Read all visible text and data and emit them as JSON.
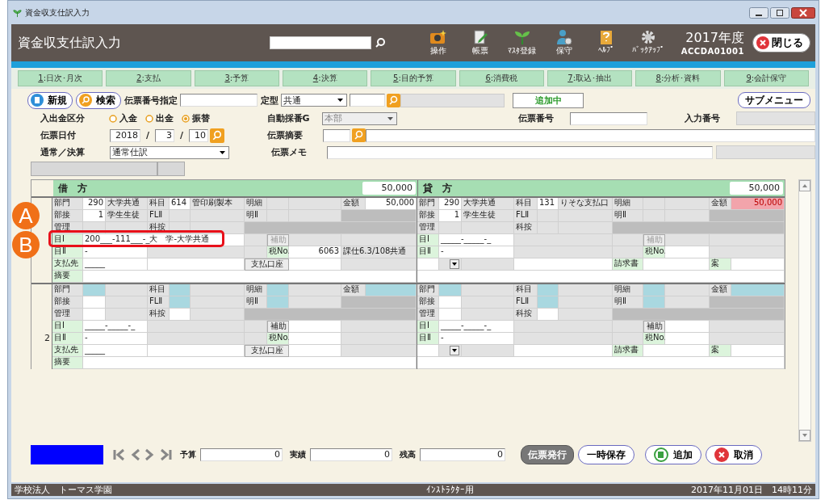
{
  "window": {
    "title": "資金収支仕訳入力"
  },
  "header": {
    "title": "資金収支仕訳入力",
    "icons": [
      {
        "kind": "camera",
        "label": "操作"
      },
      {
        "kind": "memo",
        "label": "帳票"
      },
      {
        "kind": "sprout",
        "label": "ﾏｽﾀ登録"
      },
      {
        "kind": "person",
        "label": "保守"
      },
      {
        "kind": "book",
        "label": "ﾍﾙﾌﾟ"
      },
      {
        "kind": "gear",
        "label": "ﾊﾞｯｸｱｯﾌﾟ"
      }
    ],
    "fiscal_year": "2017年度",
    "screen_id": "ACCDA01001",
    "close_button": "閉じる"
  },
  "tabs": [
    {
      "key": "1",
      "label": ":日次･月次",
      "selected": false
    },
    {
      "key": "2",
      "label": ":支払",
      "selected": false
    },
    {
      "key": "3",
      "label": ":予算",
      "selected": false
    },
    {
      "key": "4",
      "label": ":決算",
      "selected": false
    },
    {
      "key": "5",
      "label": ":目的予算",
      "selected": false
    },
    {
      "key": "6",
      "label": ":消費税",
      "selected": false
    },
    {
      "key": "7",
      "label": ":取込･抽出",
      "selected": false
    },
    {
      "key": "8",
      "label": ":分析･資料",
      "selected": false
    },
    {
      "key": "9",
      "label": ":会計保守",
      "selected": false
    }
  ],
  "form": {
    "new_button": "新規",
    "search_button": "検索",
    "voucher_no_spec_label": "伝票番号指定",
    "template_label": "定型",
    "template_value": "共通",
    "status": "追加中",
    "submenu_button": "サブメニュー",
    "direction_label": "入出金区分",
    "direction_options": [
      {
        "label": "入金",
        "selected": false
      },
      {
        "label": "出金",
        "selected": false
      },
      {
        "label": "振替",
        "selected": true
      }
    ],
    "auto_number_label": "自動採番G",
    "auto_number_value": "本部",
    "voucher_no_label": "伝票番号",
    "entry_no_label": "入力番号",
    "date_label": "伝票日付",
    "year": "2018",
    "month": "3",
    "day": "10",
    "date_separators": [
      "/",
      "/"
    ],
    "summary_label": "伝票摘要",
    "type_label": "通常／決算",
    "type_value": "通常仕訳",
    "memo_label": "伝票メモ"
  },
  "journal": {
    "debit_title": "借　方",
    "debit_total": "50,000",
    "credit_title": "貸　方",
    "credit_total": "50,000",
    "entries": [
      {
        "left": [
          [
            {
              "kind": "label",
              "text": "部門"
            },
            {
              "kind": "num",
              "text": "290"
            },
            {
              "kind": "gray",
              "text": "大学共通"
            },
            {
              "kind": "label",
              "text": "科目"
            },
            {
              "kind": "value",
              "text": "614"
            },
            {
              "kind": "gray",
              "text": "管印刷製本"
            },
            {
              "kind": "label",
              "text": "明細"
            },
            {
              "kind": "gray"
            },
            {
              "kind": "gray"
            },
            {
              "kind": "label",
              "text": "金額"
            },
            {
              "kind": "num",
              "text": "50,000"
            }
          ],
          [
            {
              "kind": "label",
              "text": "部接"
            },
            {
              "kind": "num",
              "text": "1"
            },
            {
              "kind": "gray",
              "text": "学生生徒"
            },
            {
              "kind": "label",
              "text": "FLⅡ"
            },
            {
              "kind": "gray"
            },
            {
              "kind": "gray"
            },
            {
              "kind": "label",
              "text": "明Ⅱ"
            },
            {
              "kind": "gray"
            },
            {
              "kind": "gray"
            },
            {
              "kind": "dark"
            }
          ],
          [
            {
              "kind": "label",
              "text": "管理"
            },
            {
              "kind": "gray"
            },
            {
              "kind": "gray"
            },
            {
              "kind": "label",
              "text": "科按"
            },
            {
              "kind": "gray"
            },
            {
              "kind": "gray"
            },
            {
              "kind": "dark"
            }
          ],
          [
            {
              "kind": "caption",
              "text": "目Ⅰ"
            },
            {
              "kind": "value",
              "text": "200___-111___-_大　学-大学共通"
            },
            {
              "kind": "gray"
            },
            {
              "kind": "button",
              "text": "補助",
              "disabled": true
            },
            {
              "kind": "gray"
            },
            {
              "kind": "gray"
            }
          ],
          [
            {
              "kind": "caption",
              "text": "目Ⅱ"
            },
            {
              "kind": "value",
              "text": "-"
            },
            {
              "kind": "gray"
            },
            {
              "kind": "gray"
            },
            {
              "kind": "caption",
              "text": "税No."
            },
            {
              "kind": "num",
              "text": "6063"
            },
            {
              "kind": "gray",
              "text": "課仕6.3/108共通"
            }
          ],
          [
            {
              "kind": "caption",
              "text": "支払先"
            },
            {
              "kind": "value",
              "text": "_____"
            },
            {
              "kind": "value"
            },
            {
              "kind": "button",
              "text": "支払口座",
              "disabled": false
            },
            {
              "kind": "value"
            },
            {
              "kind": "gray"
            }
          ],
          [
            {
              "kind": "caption",
              "text": "摘要"
            },
            {
              "kind": "value"
            }
          ]
        ],
        "right": [
          [
            {
              "kind": "label",
              "text": "部門"
            },
            {
              "kind": "num",
              "text": "290"
            },
            {
              "kind": "gray",
              "text": "大学共通"
            },
            {
              "kind": "label",
              "text": "科目"
            },
            {
              "kind": "value",
              "text": "131"
            },
            {
              "kind": "gray",
              "text": "りそな支払口"
            },
            {
              "kind": "label",
              "text": "明細"
            },
            {
              "kind": "gray"
            },
            {
              "kind": "gray"
            },
            {
              "kind": "label",
              "text": "金額"
            },
            {
              "kind": "pink",
              "text": "50,000"
            }
          ],
          [
            {
              "kind": "label",
              "text": "部接"
            },
            {
              "kind": "num",
              "text": "1"
            },
            {
              "kind": "gray",
              "text": "学生生徒"
            },
            {
              "kind": "label",
              "text": "FLⅡ"
            },
            {
              "kind": "gray"
            },
            {
              "kind": "gray"
            },
            {
              "kind": "label",
              "text": "明Ⅱ"
            },
            {
              "kind": "gray"
            },
            {
              "kind": "gray"
            },
            {
              "kind": "dark"
            }
          ],
          [
            {
              "kind": "label",
              "text": "管理"
            },
            {
              "kind": "gray"
            },
            {
              "kind": "gray"
            },
            {
              "kind": "label",
              "text": "科按"
            },
            {
              "kind": "gray"
            },
            {
              "kind": "gray"
            },
            {
              "kind": "dark"
            }
          ],
          [
            {
              "kind": "caption",
              "text": "目Ⅰ"
            },
            {
              "kind": "value",
              "text": "_____-_____-_"
            },
            {
              "kind": "gray"
            },
            {
              "kind": "gray"
            },
            {
              "kind": "button",
              "text": "補助",
              "disabled": true
            },
            {
              "kind": "gray"
            },
            {
              "kind": "gray"
            }
          ],
          [
            {
              "kind": "caption",
              "text": "目Ⅱ"
            },
            {
              "kind": "value",
              "text": "-"
            },
            {
              "kind": "gray"
            },
            {
              "kind": "gray"
            },
            {
              "kind": "caption",
              "text": "税No."
            },
            {
              "kind": "value"
            },
            {
              "kind": "gray"
            }
          ],
          [
            {
              "kind": "value"
            },
            {
              "kind": "drop"
            },
            {
              "kind": "gray"
            },
            {
              "kind": "value"
            },
            {
              "kind": "caption",
              "text": "請求書"
            },
            {
              "kind": "value"
            },
            {
              "kind": "caption",
              "text": "案"
            },
            {
              "kind": "value"
            }
          ],
          [
            {
              "kind": "value"
            }
          ]
        ]
      },
      {
        "number": "2",
        "left": [
          [
            {
              "kind": "label",
              "text": "部門"
            },
            {
              "kind": "blue"
            },
            {
              "kind": "gray"
            },
            {
              "kind": "label",
              "text": "科目"
            },
            {
              "kind": "blue"
            },
            {
              "kind": "gray"
            },
            {
              "kind": "label",
              "text": "明細"
            },
            {
              "kind": "blue"
            },
            {
              "kind": "gray"
            },
            {
              "kind": "label",
              "text": "金額"
            },
            {
              "kind": "blue"
            }
          ],
          [
            {
              "kind": "label",
              "text": "部接"
            },
            {
              "kind": "value"
            },
            {
              "kind": "gray"
            },
            {
              "kind": "label",
              "text": "FLⅡ"
            },
            {
              "kind": "blue"
            },
            {
              "kind": "gray"
            },
            {
              "kind": "label",
              "text": "明Ⅱ"
            },
            {
              "kind": "blue"
            },
            {
              "kind": "gray"
            },
            {
              "kind": "dark"
            }
          ],
          [
            {
              "kind": "label",
              "text": "管理"
            },
            {
              "kind": "value"
            },
            {
              "kind": "gray"
            },
            {
              "kind": "label",
              "text": "科按"
            },
            {
              "kind": "value"
            },
            {
              "kind": "gray"
            },
            {
              "kind": "dark"
            }
          ],
          [
            {
              "kind": "caption",
              "text": "目Ⅰ"
            },
            {
              "kind": "value",
              "text": "_____-_____-_"
            },
            {
              "kind": "gray"
            },
            {
              "kind": "gray"
            },
            {
              "kind": "button",
              "text": "補助",
              "disabled": false
            },
            {
              "kind": "value"
            },
            {
              "kind": "gray"
            }
          ],
          [
            {
              "kind": "caption",
              "text": "目Ⅱ"
            },
            {
              "kind": "value",
              "text": "-"
            },
            {
              "kind": "gray"
            },
            {
              "kind": "gray"
            },
            {
              "kind": "caption",
              "text": "税No."
            },
            {
              "kind": "value"
            },
            {
              "kind": "gray"
            }
          ],
          [
            {
              "kind": "caption",
              "text": "支払先"
            },
            {
              "kind": "value",
              "text": "_____"
            },
            {
              "kind": "value"
            },
            {
              "kind": "button",
              "text": "支払口座",
              "disabled": false
            },
            {
              "kind": "value"
            },
            {
              "kind": "gray"
            }
          ],
          [
            {
              "kind": "caption",
              "text": "摘要"
            },
            {
              "kind": "value"
            }
          ]
        ],
        "right": [
          [
            {
              "kind": "label",
              "text": "部門"
            },
            {
              "kind": "blue"
            },
            {
              "kind": "gray"
            },
            {
              "kind": "label",
              "text": "科目"
            },
            {
              "kind": "blue"
            },
            {
              "kind": "gray"
            },
            {
              "kind": "label",
              "text": "明細"
            },
            {
              "kind": "blue"
            },
            {
              "kind": "gray"
            },
            {
              "kind": "label",
              "text": "金額"
            },
            {
              "kind": "blue"
            }
          ],
          [
            {
              "kind": "label",
              "text": "部接"
            },
            {
              "kind": "value"
            },
            {
              "kind": "gray"
            },
            {
              "kind": "label",
              "text": "FLⅡ"
            },
            {
              "kind": "blue"
            },
            {
              "kind": "gray"
            },
            {
              "kind": "label",
              "text": "明Ⅱ"
            },
            {
              "kind": "blue"
            },
            {
              "kind": "gray"
            },
            {
              "kind": "dark"
            }
          ],
          [
            {
              "kind": "label",
              "text": "管理"
            },
            {
              "kind": "value"
            },
            {
              "kind": "gray"
            },
            {
              "kind": "label",
              "text": "科按"
            },
            {
              "kind": "value"
            },
            {
              "kind": "gray"
            },
            {
              "kind": "dark"
            }
          ],
          [
            {
              "kind": "caption",
              "text": "目Ⅰ"
            },
            {
              "kind": "value",
              "text": "_____-_____-_"
            },
            {
              "kind": "gray"
            },
            {
              "kind": "gray"
            },
            {
              "kind": "button",
              "text": "補助",
              "disabled": false
            },
            {
              "kind": "value"
            },
            {
              "kind": "gray"
            }
          ],
          [
            {
              "kind": "caption",
              "text": "目Ⅱ"
            },
            {
              "kind": "value",
              "text": "-"
            },
            {
              "kind": "gray"
            },
            {
              "kind": "gray"
            },
            {
              "kind": "caption",
              "text": "税No."
            },
            {
              "kind": "value"
            },
            {
              "kind": "gray"
            }
          ],
          [
            {
              "kind": "value"
            },
            {
              "kind": "drop"
            },
            {
              "kind": "gray"
            },
            {
              "kind": "value"
            },
            {
              "kind": "caption",
              "text": "請求書"
            },
            {
              "kind": "value"
            },
            {
              "kind": "caption",
              "text": "案"
            },
            {
              "kind": "value"
            }
          ],
          [
            {
              "kind": "value"
            }
          ]
        ]
      }
    ]
  },
  "callouts": [
    {
      "letter": "A"
    },
    {
      "letter": "B"
    }
  ],
  "footer": {
    "budget_label": "予算",
    "budget": "0",
    "actual_label": "実績",
    "actual": "0",
    "balance_label": "残高",
    "balance": "0",
    "issue_button": "伝票発行",
    "save_button": "一時保存",
    "add_button": "追加",
    "cancel_button": "取消"
  },
  "status_bar": {
    "organization": "学校法人　トーマス学園",
    "mode": "ｲﾝｽﾄﾗｸﾀｰ用",
    "datetime": "2017年11月01日　14時11分"
  }
}
